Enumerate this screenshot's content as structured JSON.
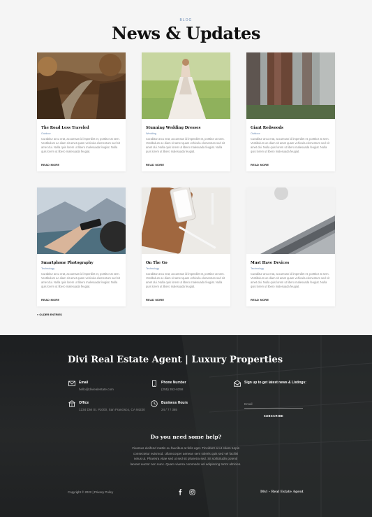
{
  "blog": {
    "eyebrow": "BLOG",
    "title": "News & Updates",
    "read_more": "READ MORE",
    "older_entries": "« OLDER ENTRIES",
    "excerpt": "Curabitur arcu erat, accumsan id imperdiet et, porttitor at sem. Vestibulum ac diam sit amet quam vehicula elementum sed sit amet dui. Nulla quis lorem ut libero malesuada feugiat. Nulla quis lorem ut libero malesuada feugiat.",
    "posts": [
      {
        "title": "The Road Less Traveled",
        "category": "Outdoor",
        "image": "forest-road-photo"
      },
      {
        "title": "Stunning Wedding Dresses",
        "category": "Wedding",
        "image": "wedding-dress-photo"
      },
      {
        "title": "Giant Redwoods",
        "category": "Outdoor",
        "image": "redwood-trees-photo"
      },
      {
        "title": "Smartphone Photography",
        "category": "Technology",
        "image": "phone-camera-photo"
      },
      {
        "title": "On The Go",
        "category": "Technology",
        "image": "phone-case-pen-photo"
      },
      {
        "title": "Must Have Devices",
        "category": "Technology",
        "image": "laptop-keyboard-photo"
      }
    ]
  },
  "footer": {
    "title": "Divi Real Estate Agent | Luxury Properties",
    "email_label": "Email",
    "email_value": "hello@diviealestate.com",
    "phone_label": "Phone Number",
    "phone_value": "(255) 352-6258",
    "office_label": "Office",
    "office_value": "1234 Divi St. #1000, San Francisco, CA 94220",
    "hours_label": "Business Hours",
    "hours_value": "24 / 7 / 365",
    "signup_label": "Sign up to get latest news & Listings:",
    "email_placeholder": "Email",
    "subscribe": "SUBSCRIBE",
    "help_title": "Do you need some help?",
    "help_text": "Vivamus eleifend mattis eu faucibus at felis eget. Tincidunt at ut etiam turpis consectetur euismod. Ullamcorper aenean sem soleris quis sed vel facilisi netus ut. Pharetra vitae sed ut sed sit pharetra sed. Sit sollicitudin potenti laoreet auctor non nunc. Quam viverra commodo vel adipiscing tortor ultricies.",
    "copyright": "Copyright © 2022 | Privacy Policy",
    "brand": "Divi – Real Estate Agent",
    "social": [
      "facebook-icon",
      "instagram-icon"
    ]
  }
}
